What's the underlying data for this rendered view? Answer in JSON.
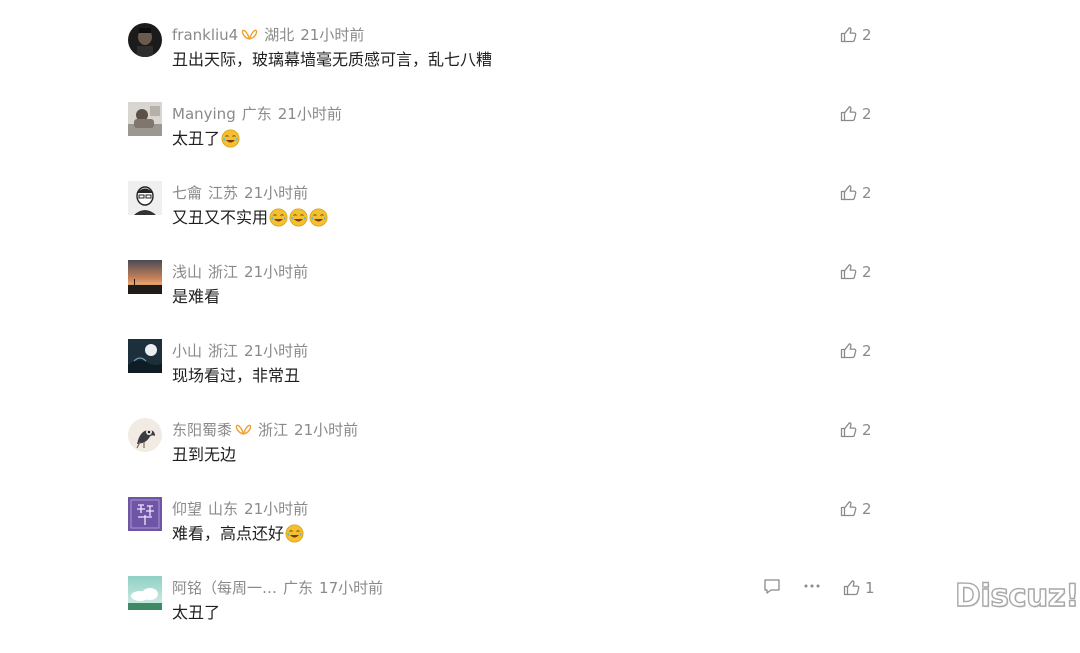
{
  "comments": [
    {
      "author": "frankliu4",
      "vip": true,
      "region": "湖北",
      "time": "21小时前",
      "text": "丑出天际，玻璃幕墙毫无质感可言，乱七八糟",
      "emoji_count": 0,
      "likes": "2",
      "avatar": "portrait-dark"
    },
    {
      "author": "Manying",
      "vip": false,
      "region": "广东",
      "time": "21小时前",
      "text": "太丑了",
      "emoji_count": 1,
      "likes": "2",
      "avatar": "photo-person-grey"
    },
    {
      "author": "七龠",
      "vip": false,
      "region": "江苏",
      "time": "21小时前",
      "text": "又丑又不实用",
      "emoji_count": 3,
      "likes": "2",
      "avatar": "sketch-face"
    },
    {
      "author": "浅山",
      "vip": false,
      "region": "浙江",
      "time": "21小时前",
      "text": "是难看",
      "emoji_count": 0,
      "likes": "2",
      "avatar": "sunset-landscape"
    },
    {
      "author": "小山",
      "vip": false,
      "region": "浙江",
      "time": "21小时前",
      "text": "现场看过，非常丑",
      "emoji_count": 0,
      "likes": "2",
      "avatar": "night-moon"
    },
    {
      "author": "东阳蜀黍",
      "vip": true,
      "region": "浙江",
      "time": "21小时前",
      "text": "丑到无边",
      "emoji_count": 0,
      "likes": "2",
      "avatar": "circle-cartoon"
    },
    {
      "author": "仰望",
      "vip": false,
      "region": "山东",
      "time": "21小时前",
      "text": "难看，高点还好",
      "emoji_count": 1,
      "likes": "2",
      "avatar": "purple-calligraphy"
    },
    {
      "author": "阿铭（每周一…",
      "vip": false,
      "region": "广东",
      "time": "17小时前",
      "text": "太丑了",
      "emoji_count": 0,
      "likes": "1",
      "avatar": "cloud-sky",
      "show_actions": true
    }
  ],
  "icons": {
    "like": "thumbs-up-icon",
    "reply": "comment-bubble-icon",
    "more": "more-dots-icon",
    "vip": "vip-butterfly-icon",
    "emoji": "laugh-cry-emoji-icon"
  },
  "colors": {
    "meta_text": "#8a8a8a",
    "body_text": "#1f1f1f",
    "vip_badge": "#f0a030",
    "emoji_yellow": "#f5c02e"
  },
  "watermark": "Discuz!"
}
